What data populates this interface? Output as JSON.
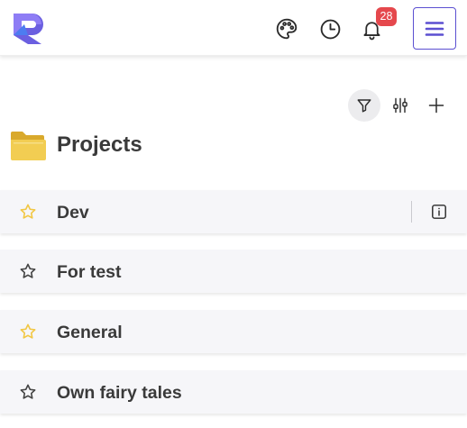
{
  "header": {
    "logo_icon": "app-logo-r",
    "palette_icon": "palette-icon",
    "history_icon": "clock-icon",
    "notifications": {
      "icon": "bell-icon",
      "count": "28"
    },
    "menu_icon": "hamburger-icon"
  },
  "toolbar": {
    "filter_icon": "filter-icon",
    "settings_icon": "sliders-icon",
    "add_icon": "plus-icon"
  },
  "page": {
    "title": "Projects",
    "title_icon": "folder-icon"
  },
  "projects": [
    {
      "name": "Dev",
      "favorite": true,
      "info_icon": "info-icon"
    },
    {
      "name": "For test",
      "favorite": false
    },
    {
      "name": "General",
      "favorite": true
    },
    {
      "name": "Own fairy tales",
      "favorite": false
    }
  ],
  "colors": {
    "accent": "#5b4fd1",
    "badge": "#e5484d",
    "star_favorite": "#f2c744",
    "star_default": "#444444",
    "folder": "#f0c94a",
    "row_background": "#f6f6f9"
  }
}
